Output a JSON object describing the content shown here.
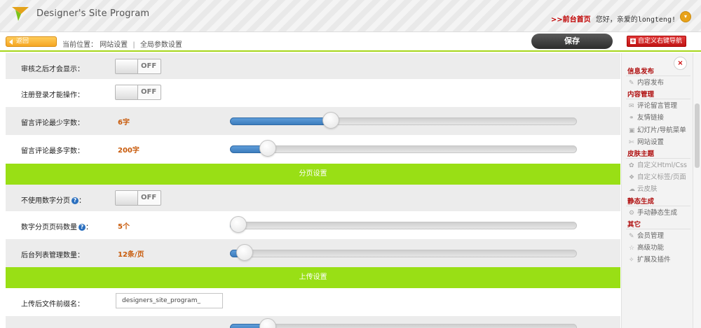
{
  "app": {
    "brand": "Designer's Site Program"
  },
  "top": {
    "front_link": ">>前台首页",
    "greeting": "您好，亲爱的",
    "username": "longteng!",
    "menu_icon": "dropdown-icon"
  },
  "toolbar": {
    "back_label": "返回",
    "crumb_prefix": "当前位置：",
    "crumb_1": "网站设置",
    "crumb_sep": "|",
    "crumb_2": "全局参数设置",
    "save_label": "保存",
    "nav_label": "自定义右键导航"
  },
  "form": {
    "review_label": "审核之后才会显示：",
    "review_toggle": "OFF",
    "login_label": "注册登录才能操作：",
    "login_toggle": "OFF",
    "min_comment_label": "留言评论最少字数：",
    "min_comment_value": "6字",
    "min_comment_fraction": 0.28,
    "max_comment_label": "留言评论最多字数：",
    "max_comment_value": "200字",
    "max_comment_fraction": 0.09,
    "section_paging": "分页设置",
    "no_number_paging_label": "不使用数字分页",
    "no_number_paging_toggle": "OFF",
    "paging_count_label": "数字分页页码数量",
    "paging_count_value": "5个",
    "paging_count_fraction": 0.0,
    "admin_list_label": "后台列表管理数量：",
    "admin_list_value": "12条/页",
    "admin_list_fraction": 0.02,
    "section_upload": "上传设置",
    "upload_prefix_label": "上传后文件前缀名：",
    "upload_prefix_value": "designers_site_program_",
    "upload_limit_fraction": 0.09
  },
  "panel": {
    "close": "×",
    "groups": [
      {
        "title": "信息发布",
        "items": [
          "内容发布"
        ]
      },
      {
        "title": "内容管理",
        "items": [
          "评论留言管理",
          "友情链接",
          "幻灯片/导航菜单",
          "网站设置"
        ]
      },
      {
        "title": "皮肤主题",
        "items": [
          "自定义Html/Css",
          "自定义标签/页面",
          "云皮肤"
        ]
      },
      {
        "title": "静态生成",
        "items": [
          "手动静态生成"
        ]
      },
      {
        "title": "其它",
        "items": [
          "会员管理",
          "高级功能",
          "扩展及插件"
        ]
      }
    ]
  },
  "colors": {
    "accent_green": "#99df15",
    "slider_blue": "#3d7dbd",
    "value_orange": "#c85a0a",
    "group_red": "#b01010"
  }
}
